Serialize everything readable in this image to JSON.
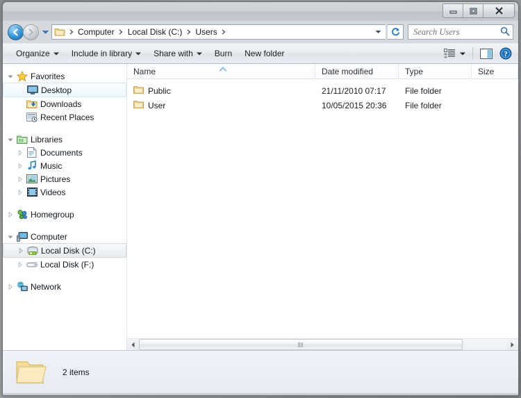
{
  "window": {
    "title": "",
    "controls": {
      "minimize": "Minimize",
      "maximize": "Maximize",
      "close": "Close"
    }
  },
  "address": {
    "back_label": "Back",
    "forward_label": "Forward",
    "history_label": "Recent pages",
    "folder_icon": "folder-icon",
    "crumbs": [
      "Computer",
      "Local Disk (C:)",
      "Users"
    ],
    "dropdown_label": "Previous locations",
    "refresh_label": "Refresh"
  },
  "search": {
    "placeholder": "Search Users",
    "value": "",
    "icon": "search-icon"
  },
  "toolbar": {
    "organize": "Organize",
    "include_in_library": "Include in library",
    "share_with": "Share with",
    "burn": "Burn",
    "new_folder": "New folder",
    "view_icon": "view-options-icon",
    "preview_icon": "preview-pane-icon",
    "help_icon": "help-icon"
  },
  "sidebar": {
    "groups": [
      {
        "header": {
          "label": "Favorites",
          "icon": "star-icon"
        },
        "items": [
          {
            "label": "Desktop",
            "icon": "desktop-icon",
            "state": "hovered"
          },
          {
            "label": "Downloads",
            "icon": "downloads-icon",
            "state": "normal"
          },
          {
            "label": "Recent Places",
            "icon": "recent-places-icon",
            "state": "normal"
          }
        ]
      },
      {
        "header": {
          "label": "Libraries",
          "icon": "libraries-icon"
        },
        "items": [
          {
            "label": "Documents",
            "icon": "documents-icon",
            "state": "normal"
          },
          {
            "label": "Music",
            "icon": "music-icon",
            "state": "normal"
          },
          {
            "label": "Pictures",
            "icon": "pictures-icon",
            "state": "normal"
          },
          {
            "label": "Videos",
            "icon": "videos-icon",
            "state": "normal"
          }
        ]
      },
      {
        "header": {
          "label": "Homegroup",
          "icon": "homegroup-icon"
        },
        "items": []
      },
      {
        "header": {
          "label": "Computer",
          "icon": "computer-icon"
        },
        "items": [
          {
            "label": "Local Disk (C:)",
            "icon": "hard-disk-icon",
            "state": "selected"
          },
          {
            "label": "Local Disk (F:)",
            "icon": "removable-disk-icon",
            "state": "normal"
          }
        ]
      },
      {
        "header": {
          "label": "Network",
          "icon": "network-icon"
        },
        "items": []
      }
    ]
  },
  "filelist": {
    "columns": [
      {
        "label": "Name",
        "sorted": "ascending"
      },
      {
        "label": "Date modified",
        "sorted": "none"
      },
      {
        "label": "Type",
        "sorted": "none"
      },
      {
        "label": "Size",
        "sorted": "none"
      }
    ],
    "rows": [
      {
        "name": "Public",
        "date_modified": "21/11/2010 07:17",
        "type": "File folder",
        "size": "",
        "icon": "folder-icon"
      },
      {
        "name": "User",
        "date_modified": "10/05/2015 20:36",
        "type": "File folder",
        "size": "",
        "icon": "folder-icon"
      }
    ]
  },
  "statusbar": {
    "icon": "folder-large-icon",
    "text": "2 items"
  },
  "colors": {
    "accent_blue": "#1667ab",
    "folder_yellow": "#f5d27a",
    "selection_blue": "#d4e7f5",
    "window_chrome": "#d7dade"
  }
}
